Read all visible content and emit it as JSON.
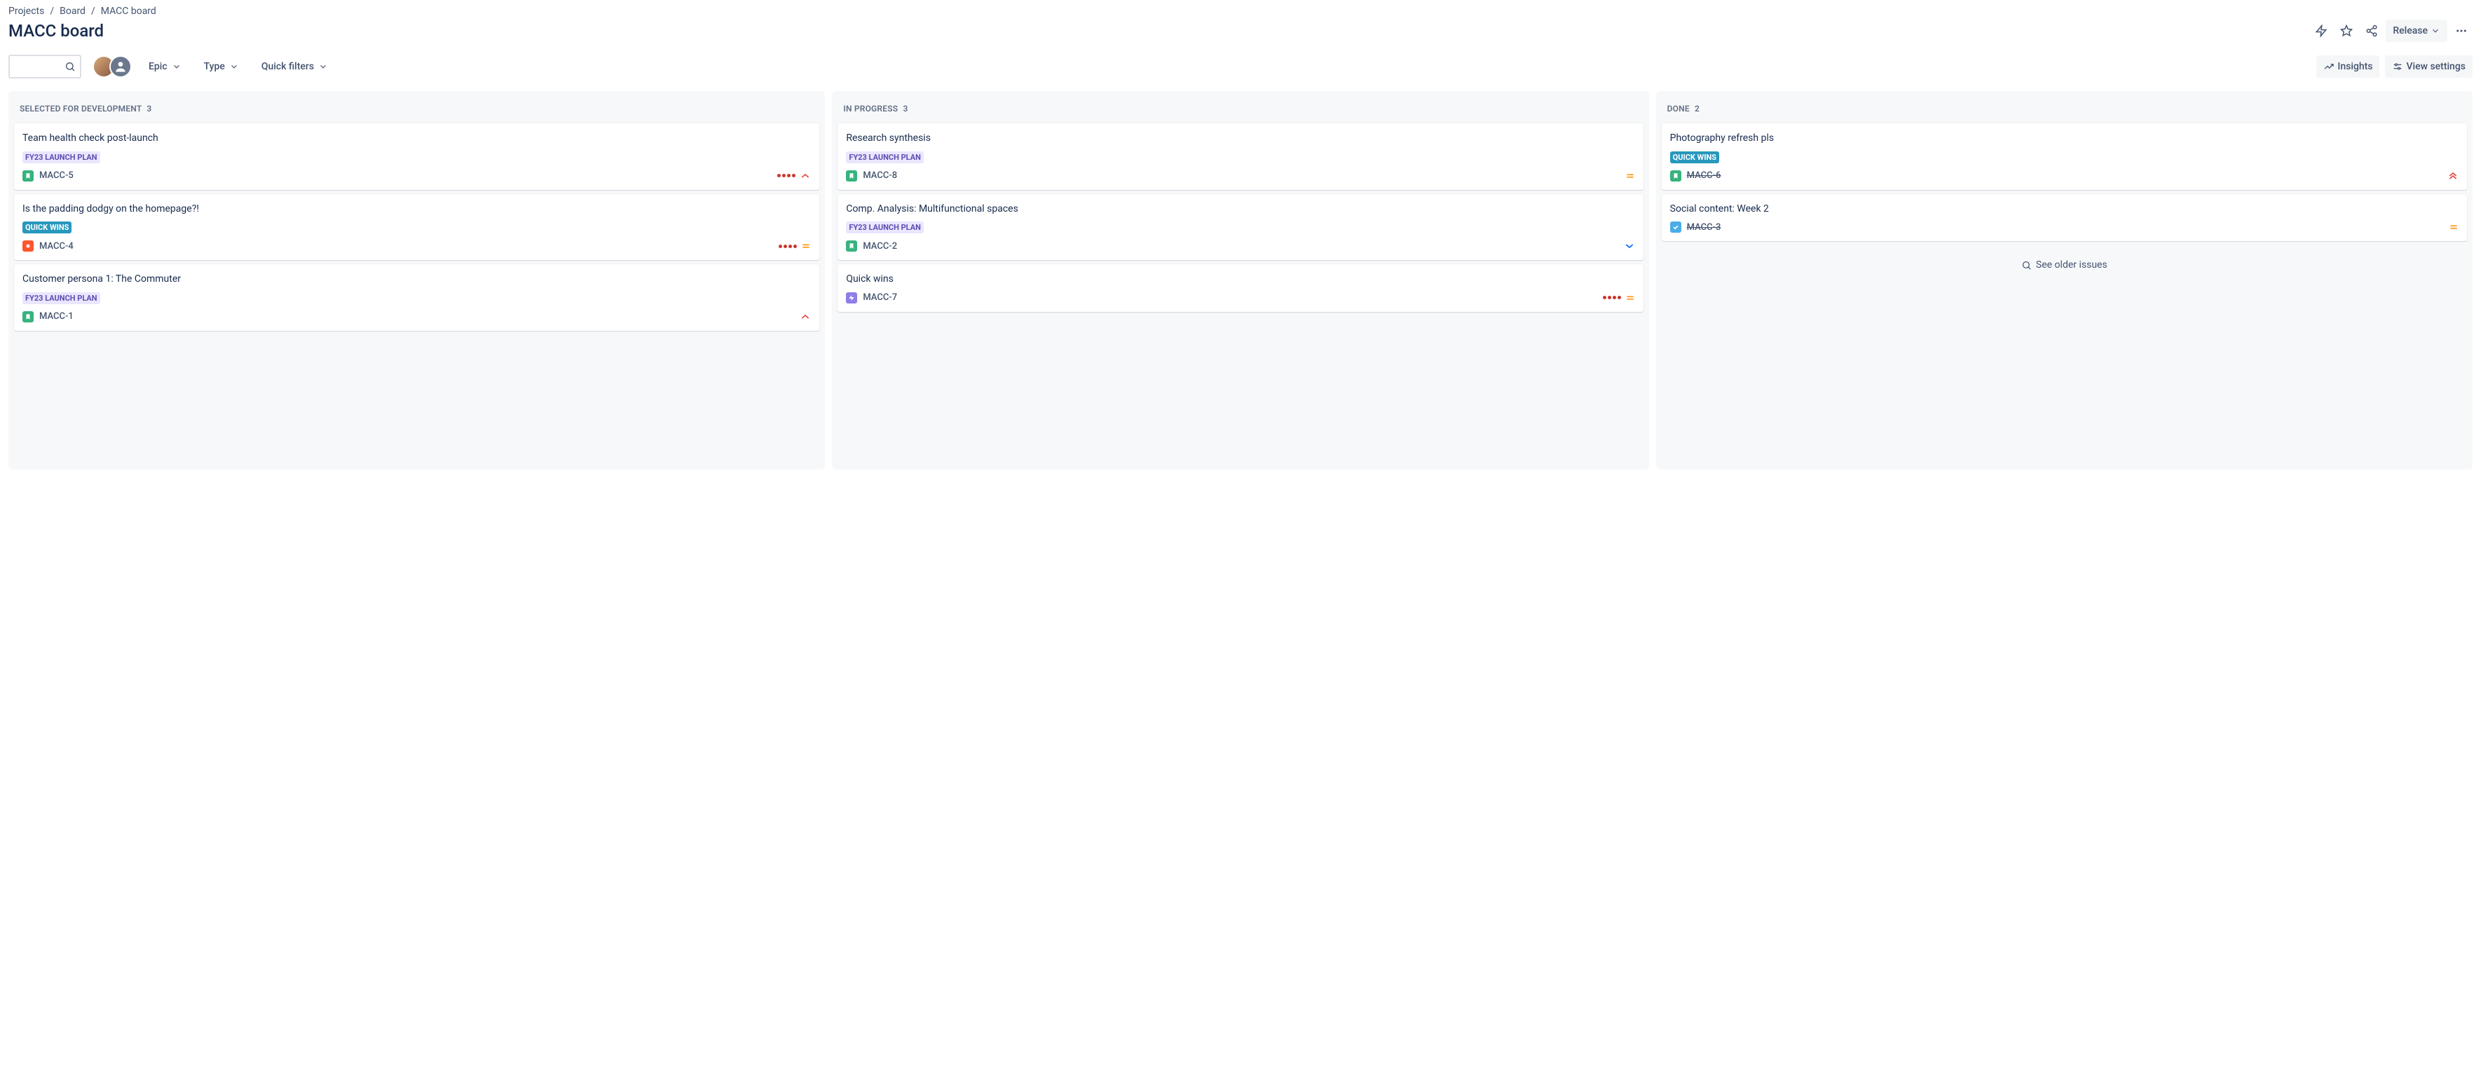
{
  "breadcrumbs": [
    "Projects",
    "Board",
    "MACC board"
  ],
  "page_title": "MACC board",
  "header": {
    "release_label": "Release"
  },
  "toolbar": {
    "filters": {
      "epic": "Epic",
      "type": "Type",
      "quick": "Quick filters"
    },
    "insights": "Insights",
    "view_settings": "View settings"
  },
  "tags": {
    "launch": "FY23 LAUNCH PLAN",
    "quick": "QUICK WINS"
  },
  "columns": [
    {
      "name": "Selected for Development",
      "count": "3",
      "cards": [
        {
          "title": "Team health check post-launch",
          "tag": "launch",
          "type": "story",
          "key": "MACC-5",
          "done": false,
          "dots": true,
          "priority": "high"
        },
        {
          "title": "Is the padding dodgy on the homepage?!",
          "tag": "quick",
          "type": "bug",
          "key": "MACC-4",
          "done": false,
          "dots": true,
          "priority": "medium"
        },
        {
          "title": "Customer persona 1: The Commuter",
          "tag": "launch",
          "type": "story",
          "key": "MACC-1",
          "done": false,
          "dots": false,
          "priority": "high"
        }
      ]
    },
    {
      "name": "In Progress",
      "count": "3",
      "cards": [
        {
          "title": "Research synthesis",
          "tag": "launch",
          "type": "story",
          "key": "MACC-8",
          "done": false,
          "dots": false,
          "priority": "medium"
        },
        {
          "title": "Comp. Analysis: Multifunctional spaces",
          "tag": "launch",
          "type": "story",
          "key": "MACC-2",
          "done": false,
          "dots": false,
          "priority": "low"
        },
        {
          "title": "Quick wins",
          "tag": null,
          "type": "epic",
          "key": "MACC-7",
          "done": false,
          "dots": true,
          "priority": "medium"
        }
      ]
    },
    {
      "name": "Done",
      "count": "2",
      "see_older": "See older issues",
      "cards": [
        {
          "title": "Photography refresh pls",
          "tag": "quick",
          "type": "story",
          "key": "MACC-6",
          "done": true,
          "dots": false,
          "priority": "highest"
        },
        {
          "title": "Social content: Week 2",
          "tag": null,
          "type": "task",
          "key": "MACC-3",
          "done": true,
          "dots": false,
          "priority": "medium"
        }
      ]
    }
  ]
}
